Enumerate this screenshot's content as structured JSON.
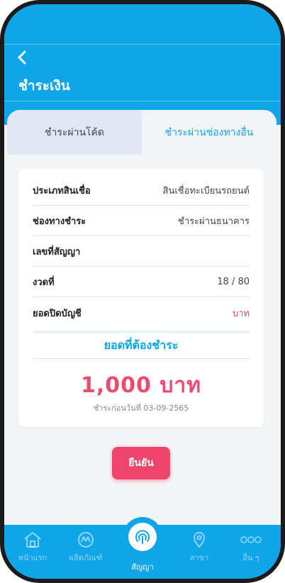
{
  "header": {
    "title": "ชำระเงิน",
    "back_icon": "chevron-left-icon"
  },
  "tabs": [
    {
      "label": "ชำระผ่านโค้ด",
      "active": false
    },
    {
      "label": "ชำระผ่านช่องทางอื่น",
      "active": true
    }
  ],
  "details": [
    {
      "label": "ประเภทสินเชื่อ",
      "value": "สินเชื่อทะเบียนรถยนต์"
    },
    {
      "label": "ช่องทางชำระ",
      "value": "ชำระผ่านธนาคาร"
    },
    {
      "label": "เลขที่สัญญา",
      "value": ""
    },
    {
      "label": "งวดที่",
      "value": "18 / 80"
    },
    {
      "label": "ยอดปิดบัญชี",
      "value": "บาท"
    }
  ],
  "total": {
    "title": "ยอดที่ต้องชำระ",
    "amount": "1,000 บาท",
    "due_text": "ชำระก่อนวันที่ 03-09-2565"
  },
  "confirm_label": "ยืนยัน",
  "nav": [
    {
      "label": "หน้าแรก",
      "icon": "home-icon"
    },
    {
      "label": "ผลิตภัณฑ์",
      "icon": "product-icon"
    },
    {
      "label": "สัญญา",
      "icon": "contract-icon",
      "active": true
    },
    {
      "label": "สาขา",
      "icon": "location-pin-icon"
    },
    {
      "label": "อื่น ๆ",
      "icon": "more-icon"
    }
  ],
  "colors": {
    "primary": "#0ea5e9",
    "accent": "#f0456b",
    "amount": "#ec4a6f"
  }
}
